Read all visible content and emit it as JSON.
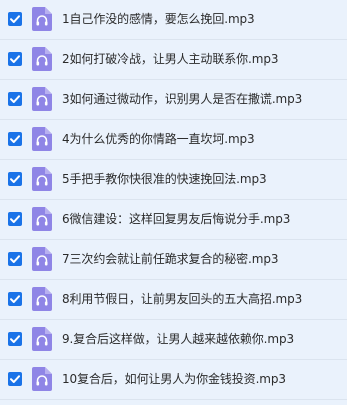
{
  "file_list": {
    "items": [
      {
        "name": "1自己作没的感情，要怎么挽回.mp3",
        "checked": true,
        "icon": "audio-file-icon"
      },
      {
        "name": "2如何打破冷战，让男人主动联系你.mp3",
        "checked": true,
        "icon": "audio-file-icon"
      },
      {
        "name": "3如何通过微动作，识别男人是否在撒谎.mp3",
        "checked": true,
        "icon": "audio-file-icon"
      },
      {
        "name": "4为什么优秀的你情路一直坎坷.mp3",
        "checked": true,
        "icon": "audio-file-icon"
      },
      {
        "name": "5手把手教你快很准的快速挽回法.mp3",
        "checked": true,
        "icon": "audio-file-icon"
      },
      {
        "name": "6微信建设：这样回复男友后悔说分手.mp3",
        "checked": true,
        "icon": "audio-file-icon"
      },
      {
        "name": "7三次约会就让前任跪求复合的秘密.mp3",
        "checked": true,
        "icon": "audio-file-icon"
      },
      {
        "name": "8利用节假日，让前男友回头的五大高招.mp3",
        "checked": true,
        "icon": "audio-file-icon"
      },
      {
        "name": "9.复合后这样做，让男人越来越依赖你.mp3",
        "checked": true,
        "icon": "audio-file-icon"
      },
      {
        "name": "10复合后，如何让男人为你金钱投资.mp3",
        "checked": true,
        "icon": "audio-file-icon"
      }
    ]
  },
  "colors": {
    "background": "#eaf2fc",
    "checkbox": "#1a73e8",
    "icon": "#8f85e6"
  }
}
